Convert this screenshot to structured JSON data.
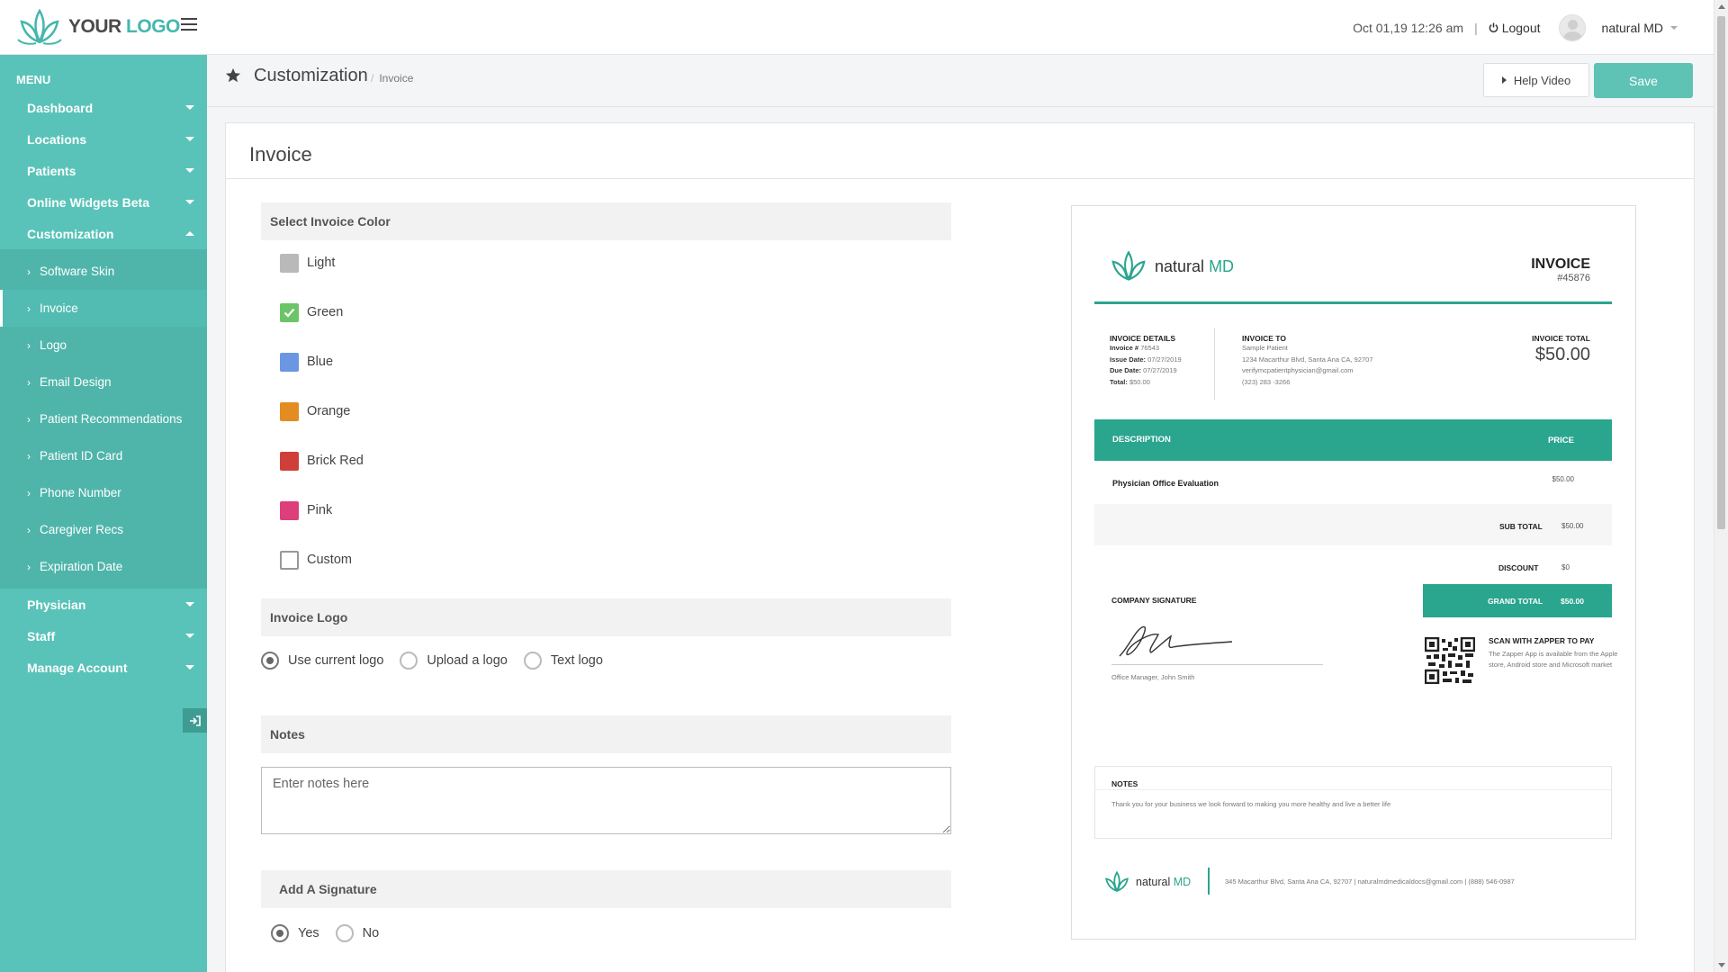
{
  "header": {
    "logo_your": "YOUR",
    "logo_logo": "LOGO",
    "datetime": "Oct 01,19 12:26 am",
    "separator": "|",
    "logout": "Logout",
    "username": "natural MD"
  },
  "sidebar": {
    "menu_title": "MENU",
    "items_top": [
      {
        "label": "Dashboard"
      },
      {
        "label": "Locations"
      },
      {
        "label": "Patients"
      },
      {
        "label": "Online Widgets Beta"
      },
      {
        "label": "Customization"
      }
    ],
    "sub_items": [
      {
        "label": "Software Skin"
      },
      {
        "label": "Invoice"
      },
      {
        "label": "Logo"
      },
      {
        "label": "Email Design"
      },
      {
        "label": "Patient Recommendations"
      },
      {
        "label": "Patient ID Card"
      },
      {
        "label": "Phone Number"
      },
      {
        "label": "Caregiver Recs"
      },
      {
        "label": "Expiration Date"
      }
    ],
    "items_bottom": [
      {
        "label": "Physician"
      },
      {
        "label": "Staff"
      },
      {
        "label": "Manage Account"
      }
    ]
  },
  "page": {
    "title": "Customization",
    "crumb_sep": "/",
    "crumb": "Invoice",
    "help_label": "Help Video",
    "save_label": "Save"
  },
  "panel": {
    "title": "Invoice",
    "color_section": "Select Invoice Color",
    "colors": [
      {
        "label": "Light",
        "hex": "#b9b9b9"
      },
      {
        "label": "Green",
        "hex": "#6cc468"
      },
      {
        "label": "Blue",
        "hex": "#6b96e2"
      },
      {
        "label": "Orange",
        "hex": "#e28c22"
      },
      {
        "label": "Brick Red",
        "hex": "#cf3f3a"
      },
      {
        "label": "Pink",
        "hex": "#dc3f7a"
      },
      {
        "label": "Custom",
        "hex": "#ffffff"
      }
    ],
    "selected_color": "Green",
    "logo_section": "Invoice Logo",
    "logo_options": [
      "Use current logo",
      "Upload a logo",
      "Text logo"
    ],
    "notes_section": "Notes",
    "notes_placeholder": "Enter notes here",
    "signature_section": "Add A Signature",
    "signature_options": [
      "Yes",
      "No"
    ]
  },
  "preview": {
    "brand_a": "natural",
    "brand_b": "MD",
    "invoice_title": "INVOICE",
    "invoice_num": "#45876",
    "details_h": "INVOICE DETAILS",
    "d1_l": "Invoice #",
    "d1_v": "76543",
    "d2_l": "Issue Date:",
    "d2_v": "07/27/2019",
    "d3_l": "Due Date:",
    "d3_v": "07/27/2019",
    "d4_l": "Total:",
    "d4_v": "$50.00",
    "to_h": "INVOICE TO",
    "to_1": "Sample Patient",
    "to_2": "1234 Macarthur Blvd, Santa Ana CA, 92707",
    "to_3": "verifymcpatientphysician@gmail.com",
    "to_4": "(323) 283 -3266",
    "total_h": "INVOICE TOTAL",
    "total_v": "$50.00",
    "col_desc": "DESCRIPTION",
    "col_price": "PRICE",
    "item_desc": "Physician Office Evaluation",
    "item_price": "$50.00",
    "subtotal_l": "SUB TOTAL",
    "subtotal_v": "$50.00",
    "discount_l": "DISCOUNT",
    "discount_v": "$0",
    "grand_l": "GRAND TOTAL",
    "grand_v": "$50.00",
    "sig_h": "COMPANY SIGNATURE",
    "sig_name": "Office Manager, John Smith",
    "scan_h": "SCAN WITH ZAPPER TO PAY",
    "scan_t": "The Zapper App is available from the Apple store, Android store and Microsoft market",
    "notes_h": "NOTES",
    "notes_t": "Thank you for your business we look forward to making you more healthy and live a better life",
    "footer": "345 Macarthur Blvd, Santa Ana CA, 92707  |  naturalmdmedicaldocs@gmail.com  |  (888) 546-0987",
    "accent": "#2aa58e"
  }
}
